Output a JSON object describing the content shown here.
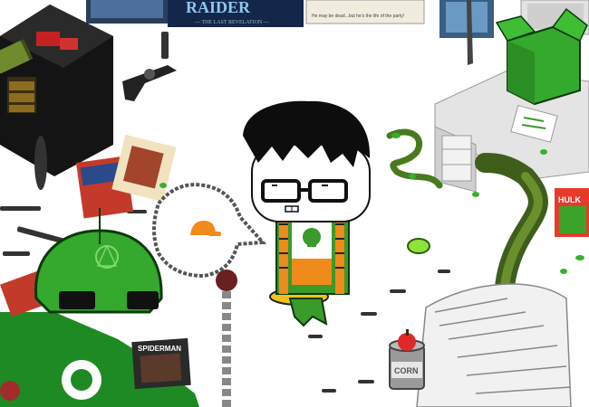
{
  "posters": {
    "raider_title": "RAIDER",
    "raider_subtitle": "— THE LAST REVELATION —",
    "caption_line1": "He may be dead...but he's the life of the party!"
  },
  "items": {
    "corn_can_label": "CORN",
    "spiderman_comic": "SPIDERMAN",
    "hulk_comic": "HULK"
  },
  "speech_bubble": {
    "icon": "orange-cap-icon"
  },
  "colors": {
    "skin": "#ffffff",
    "shirt_green": "#3a9a2a",
    "pants_green": "#45b02e",
    "shoe_yellow": "#f2c21a",
    "box_green": "#35a82e",
    "desk_gray": "#e4e4e4",
    "floor": "#ffffff"
  }
}
